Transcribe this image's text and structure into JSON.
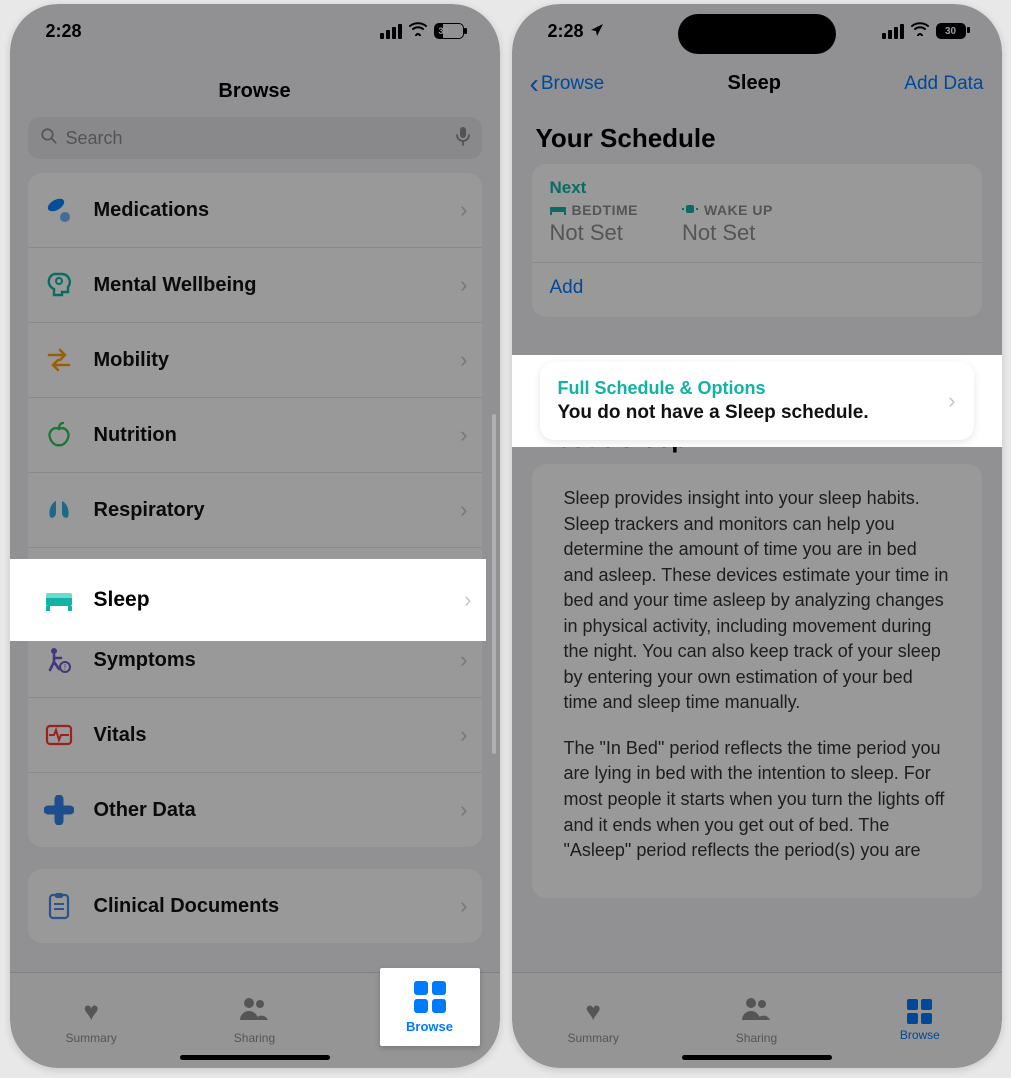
{
  "left": {
    "status_time": "2:28",
    "battery": "30",
    "title": "Browse",
    "search_placeholder": "Search",
    "categories": [
      {
        "label": "Medications",
        "icon": "pill",
        "color": "c-blue"
      },
      {
        "label": "Mental Wellbeing",
        "icon": "brain",
        "color": "c-teal"
      },
      {
        "label": "Mobility",
        "icon": "arrows",
        "color": "c-orange"
      },
      {
        "label": "Nutrition",
        "icon": "apple",
        "color": "c-green"
      },
      {
        "label": "Respiratory",
        "icon": "lungs",
        "color": "c-cyan"
      },
      {
        "label": "Sleep",
        "icon": "bed",
        "color": "c-teal"
      },
      {
        "label": "Symptoms",
        "icon": "symptom",
        "color": "c-purple"
      },
      {
        "label": "Vitals",
        "icon": "ecg",
        "color": "c-red"
      },
      {
        "label": "Other Data",
        "icon": "plus",
        "color": "c-blue2"
      }
    ],
    "clinical_label": "Clinical Documents",
    "tabs": {
      "summary": "Summary",
      "sharing": "Sharing",
      "browse": "Browse"
    }
  },
  "right": {
    "status_time": "2:28",
    "battery": "30",
    "back_label": "Browse",
    "title": "Sleep",
    "add_data": "Add Data",
    "schedule_title": "Your Schedule",
    "next_label": "Next",
    "bedtime_label": "BEDTIME",
    "bedtime_value": "Not Set",
    "wakeup_label": "WAKE UP",
    "wakeup_value": "Not Set",
    "add_label": "Add",
    "full_title": "Full Schedule & Options",
    "full_sub": "You do not have a Sleep schedule.",
    "about_title": "About Sleep",
    "about_p1": "Sleep provides insight into your sleep habits. Sleep trackers and monitors can help you determine the amount of time you are in bed and asleep. These devices estimate your time in bed and your time asleep by analyzing changes in physical activity, including movement during the night. You can also keep track of your sleep by entering your own estimation of your bed time and sleep time manually.",
    "about_p2": "The \"In Bed\" period reflects the time period you are lying in bed with the intention to sleep. For most people it starts when you turn the lights off and it ends when you get out of bed. The \"Asleep\" period reflects the period(s) you are",
    "tabs": {
      "summary": "Summary",
      "sharing": "Sharing",
      "browse": "Browse"
    }
  }
}
